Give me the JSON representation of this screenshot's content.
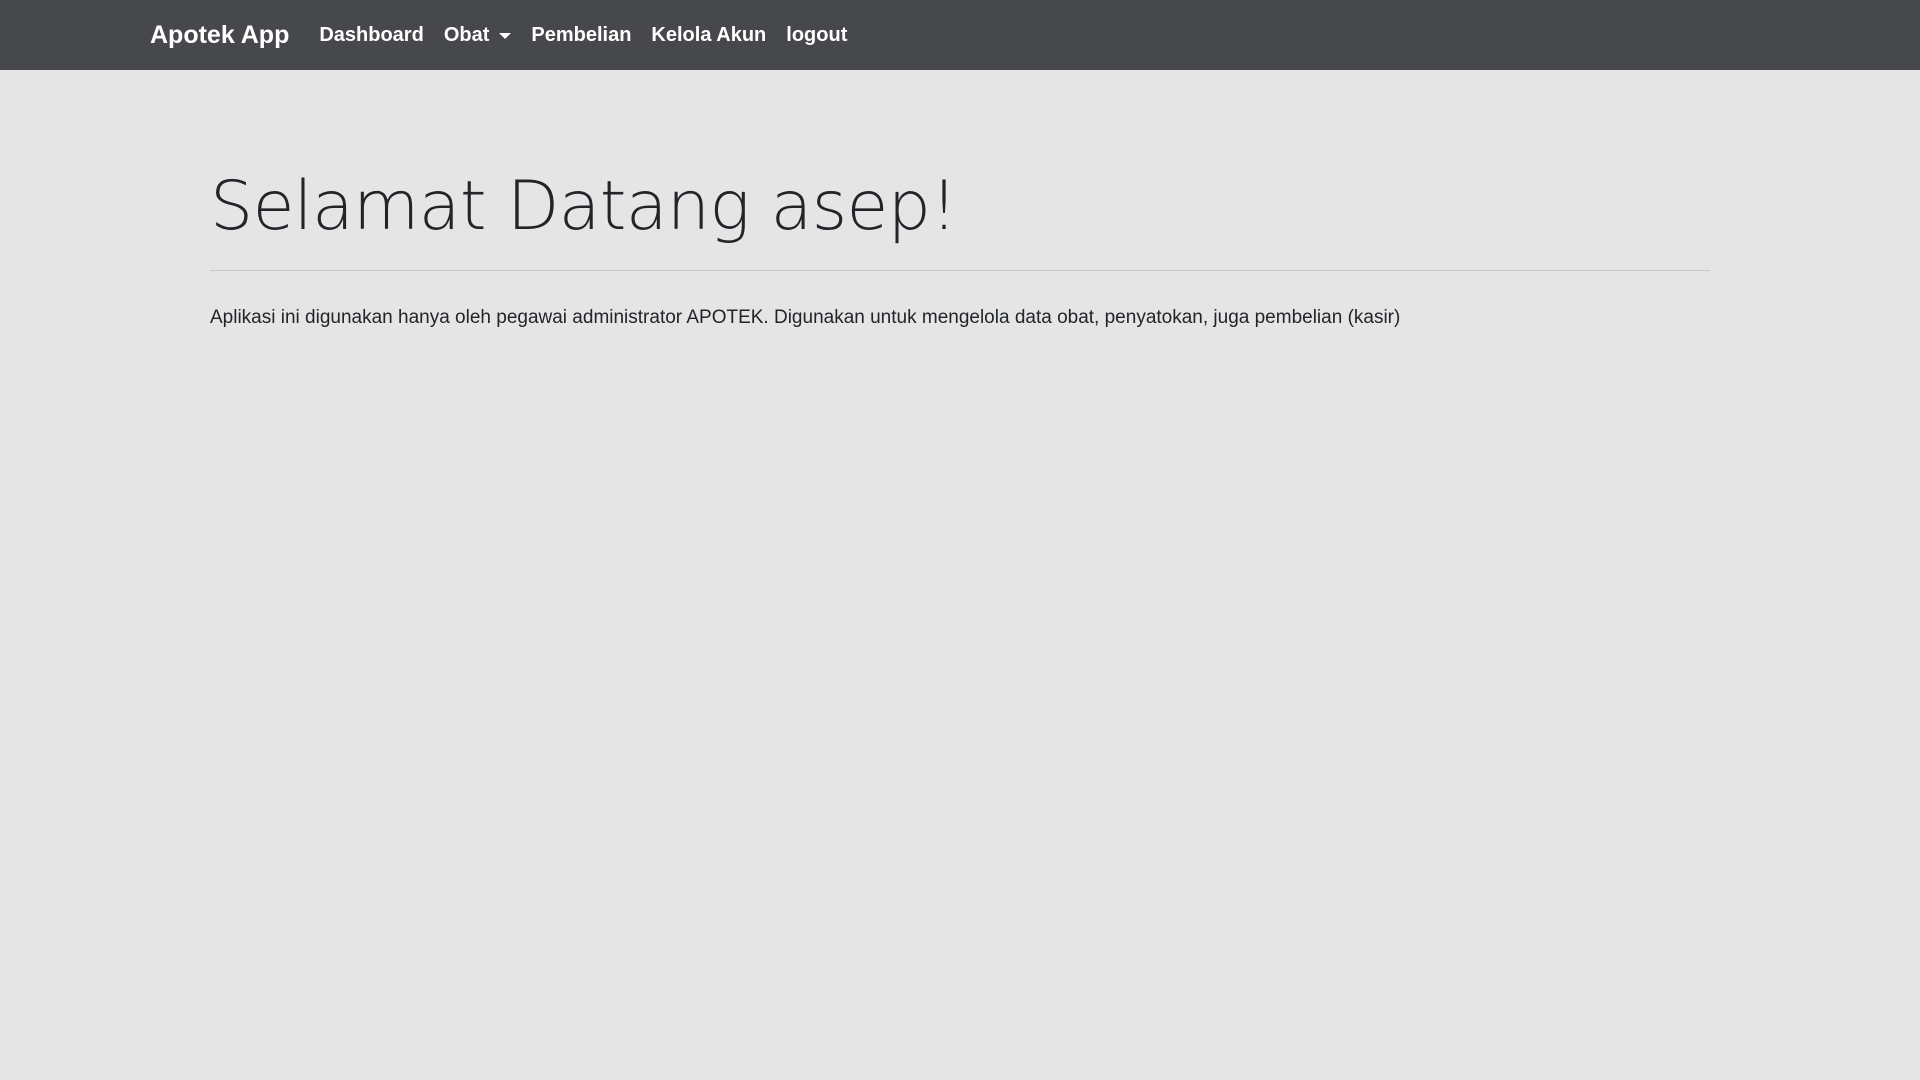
{
  "navbar": {
    "brand": "Apotek App",
    "items": [
      {
        "label": "Dashboard",
        "icon": null
      },
      {
        "label": "Obat",
        "icon": "chevron-down-icon"
      },
      {
        "label": "Pembelian",
        "icon": null
      },
      {
        "label": "Kelola Akun",
        "icon": null
      },
      {
        "label": "logout",
        "icon": null
      }
    ],
    "background_color": "#46484c"
  },
  "main": {
    "title": "Selamat Datang asep!",
    "description": "Aplikasi ini digunakan hanya oleh pegawai administrator APOTEK. Digunakan untuk mengelola data obat, penyatokan, juga pembelian (kasir)",
    "background_color": "#e5e5e5"
  }
}
